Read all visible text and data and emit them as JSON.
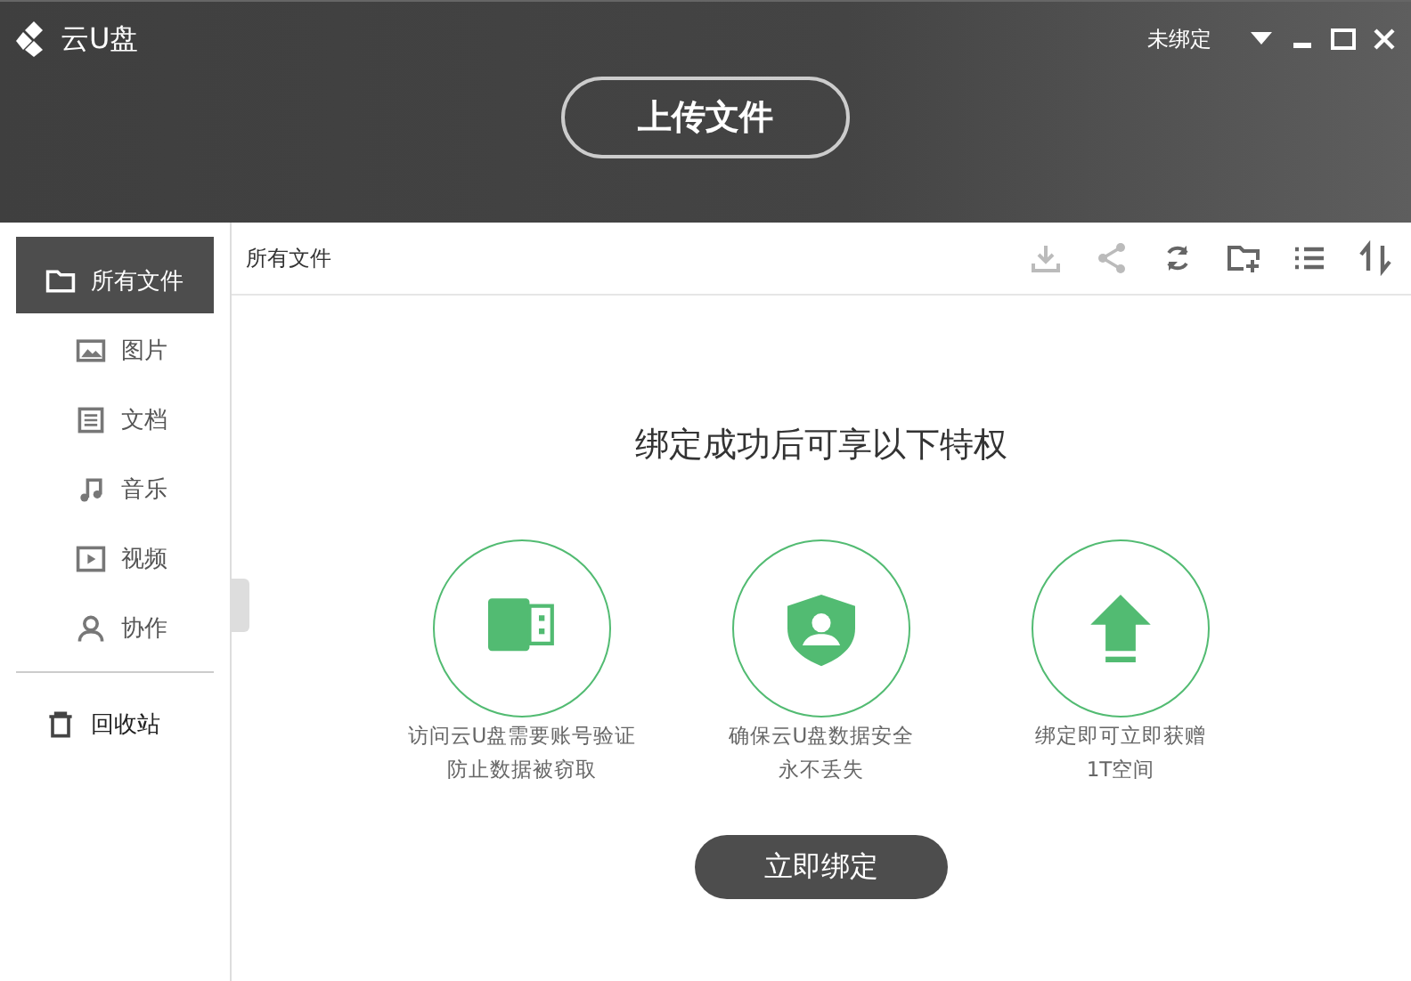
{
  "header": {
    "app_name": "云U盘",
    "account_status": "未绑定",
    "upload_button": "上传文件"
  },
  "sidebar": {
    "items": [
      {
        "label": "所有文件",
        "kind": "folder",
        "selected": true,
        "children": [
          {
            "label": "图片",
            "kind": "image",
            "selected": false
          },
          {
            "label": "文档",
            "kind": "document",
            "selected": false
          },
          {
            "label": "音乐",
            "kind": "music",
            "selected": false
          },
          {
            "label": "视频",
            "kind": "video",
            "selected": false
          },
          {
            "label": "协作",
            "kind": "person",
            "selected": false
          }
        ]
      }
    ],
    "trash": {
      "label": "回收站",
      "selected": false
    }
  },
  "toolbar": {
    "breadcrumb": "所有文件",
    "tools": [
      {
        "kind": "download",
        "disabled": true
      },
      {
        "kind": "share",
        "disabled": true
      },
      {
        "kind": "refresh",
        "disabled": false
      },
      {
        "kind": "new-folder",
        "disabled": false
      },
      {
        "kind": "list",
        "disabled": false
      },
      {
        "kind": "sort",
        "disabled": false
      }
    ]
  },
  "promo": {
    "heading": "绑定成功后可享以下特权",
    "features": [
      {
        "kind": "usb",
        "lines": [
          "访问云U盘需要账号验证",
          "防止数据被窃取"
        ]
      },
      {
        "kind": "shield",
        "lines": [
          "确保云U盘数据安全",
          "永不丢失"
        ]
      },
      {
        "kind": "upload",
        "lines": [
          "绑定即可立即获赠",
          "1T空间"
        ]
      }
    ],
    "bind_button": "立即绑定"
  }
}
